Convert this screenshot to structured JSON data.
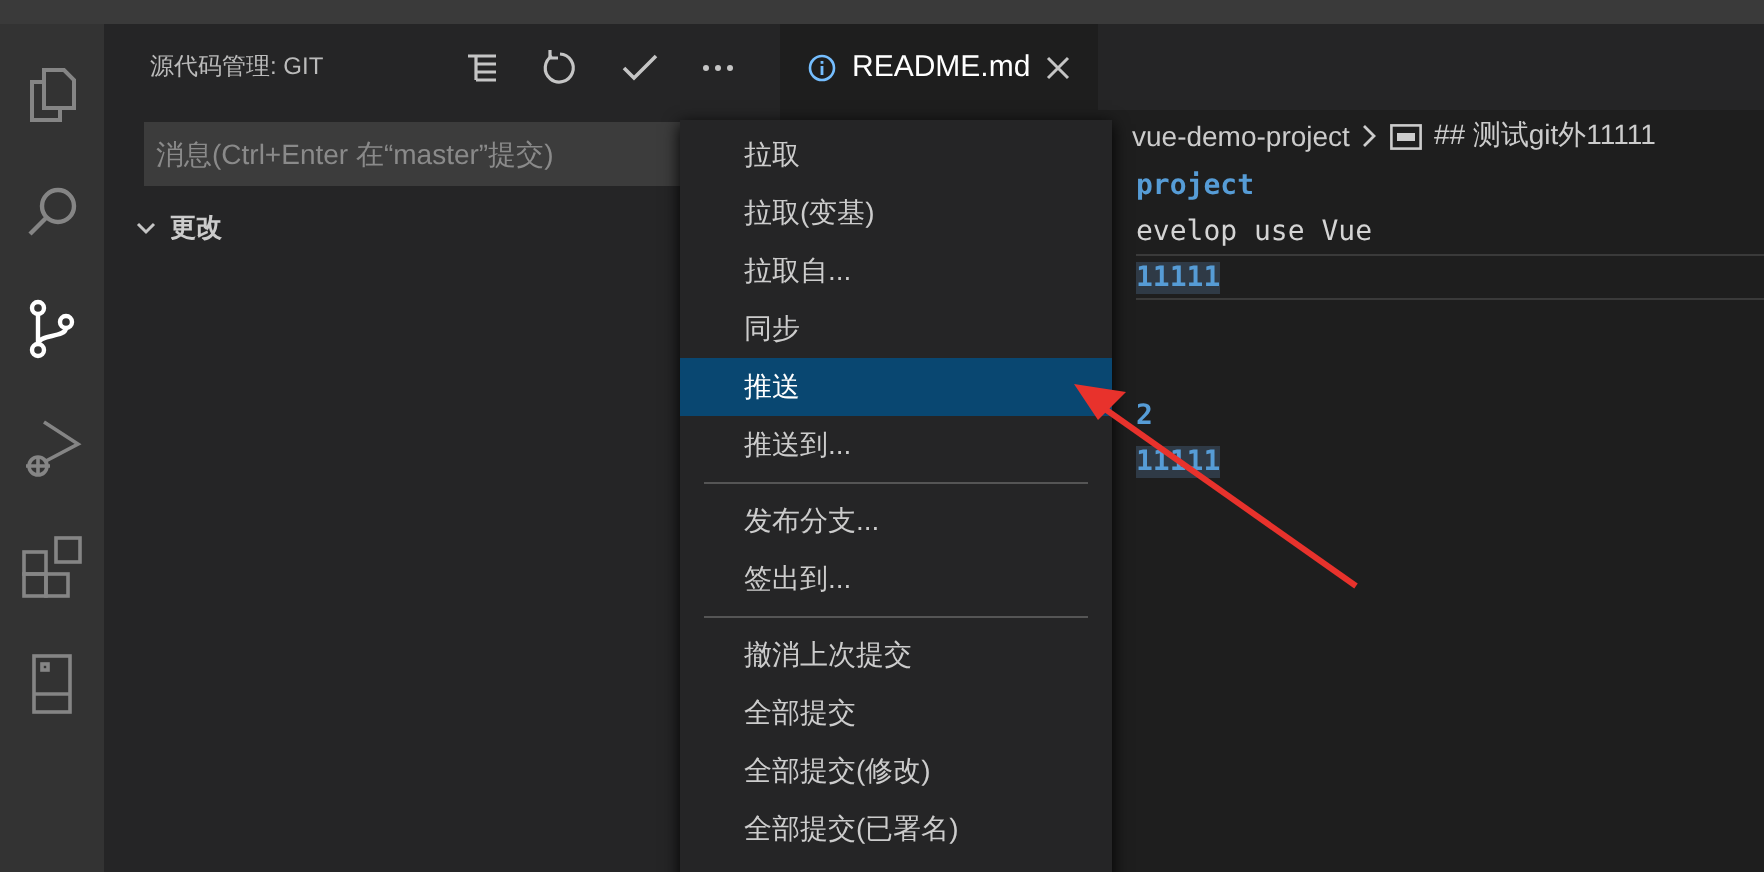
{
  "activity_bar": [
    {
      "kind": "explorer",
      "selected": false
    },
    {
      "kind": "search",
      "selected": false
    },
    {
      "kind": "source-control",
      "selected": true
    },
    {
      "kind": "debug",
      "selected": false
    },
    {
      "kind": "extensions",
      "selected": false
    },
    {
      "kind": "remote",
      "selected": false
    }
  ],
  "sidebar": {
    "title": "源代码管理: GIT",
    "message": {
      "placeholder": "消息(Ctrl+Enter 在“master”提交)"
    },
    "section": {
      "label": "更改",
      "expanded": true
    }
  },
  "tab": {
    "label": "README.md",
    "selected": true
  },
  "breadcrumb": [
    "vue-demo-project",
    "## 测试git外11111"
  ],
  "editor_lines": [
    {
      "kind": "heading",
      "text": "project",
      "highlighted": false,
      "current": false
    },
    {
      "kind": "plain",
      "text": "evelop use Vue",
      "highlighted": false,
      "current": false
    },
    {
      "kind": "heading",
      "text": "11111",
      "highlighted": true,
      "current": true
    },
    {
      "kind": "blank"
    },
    {
      "kind": "blank"
    },
    {
      "kind": "heading",
      "text": "2",
      "highlighted": false,
      "current": false
    },
    {
      "kind": "heading",
      "text": "11111",
      "highlighted": true,
      "current": false
    }
  ],
  "menu": [
    [
      {
        "label": "拉取",
        "selected": false
      },
      {
        "label": "拉取(变基)",
        "selected": false
      },
      {
        "label": "拉取自...",
        "selected": false
      },
      {
        "label": "同步",
        "selected": false
      },
      {
        "label": "推送",
        "selected": true
      },
      {
        "label": "推送到...",
        "selected": false
      }
    ],
    [
      {
        "label": "发布分支...",
        "selected": false
      },
      {
        "label": "签出到...",
        "selected": false
      }
    ],
    [
      {
        "label": "撤消上次提交",
        "selected": false
      },
      {
        "label": "全部提交",
        "selected": false
      },
      {
        "label": "全部提交(修改)",
        "selected": false
      },
      {
        "label": "全部提交(已署名)",
        "selected": false
      }
    ]
  ]
}
